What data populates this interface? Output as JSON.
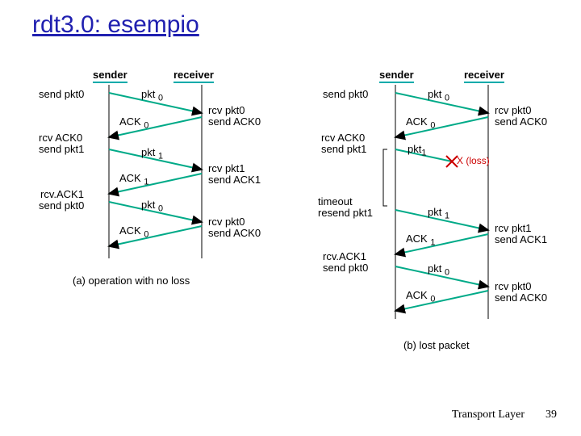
{
  "title": "rdt3.0: esempio",
  "footer": {
    "label": "Transport Layer",
    "page": "39"
  },
  "headers": {
    "sender": "sender",
    "receiver": "receiver"
  },
  "labels": {
    "send_pkt0": "send pkt0",
    "rcv_pkt0": "rcv pkt0",
    "send_ack0": "send ACK0",
    "rcv_ack0": "rcv ACK0",
    "send_pkt1": "send pkt1",
    "rcv_pkt1": "rcv pkt1",
    "send_ack1": "send ACK1",
    "rcv_ack1": "rcv.ACK1",
    "timeout": "timeout",
    "resend_pkt1": "resend pkt1",
    "pkt0": "pkt",
    "pkt0_sub": "0",
    "pkt1": "pkt",
    "pkt1_sub": "1",
    "ack0": "ACK",
    "ack0_sub": "0",
    "ack1": "ACK",
    "ack1_sub": "1",
    "loss": "(loss)",
    "x": "X"
  },
  "captions": {
    "a": "(a) operation with no loss",
    "b": "(b) lost packet"
  }
}
